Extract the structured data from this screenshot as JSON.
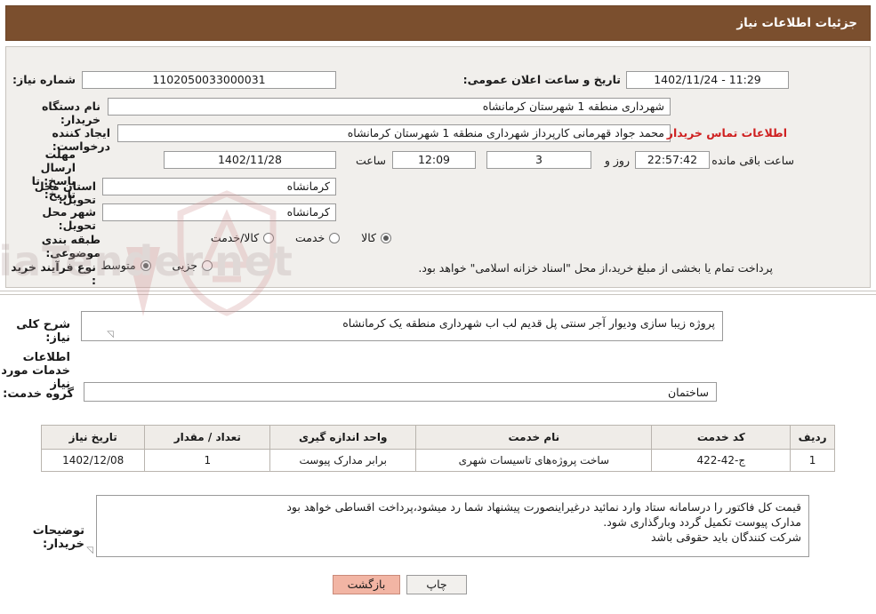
{
  "header": {
    "title": "جزئیات اطلاعات نیاز"
  },
  "form": {
    "need_number_label": "شماره نیاز:",
    "need_number_value": "1102050033000031",
    "announce_datetime_label": "تاریخ و ساعت اعلان عمومی:",
    "announce_datetime_value": "11:29 - 1402/11/24",
    "buyer_org_label": "نام دستگاه خریدار:",
    "buyer_org_value": "شهرداری منطقه 1 شهرستان کرمانشاه",
    "requester_label": "ایجاد کننده درخواست:",
    "requester_value": "محمد جواد قهرمانی کارپرداز شهرداری منطقه 1 شهرستان کرمانشاه",
    "contact_link": "اطلاعات تماس خریدار",
    "deadline_label": "مهلت ارسال پاسخ: تا تاریخ:",
    "deadline_date": "1402/11/28",
    "deadline_hour_label": "ساعت",
    "deadline_hour": "12:09",
    "remaining_days": "3",
    "remaining_days_suffix": "روز و",
    "remaining_time": "22:57:42",
    "remaining_suffix": "ساعت باقی مانده",
    "province_label": "استان محل تحویل:",
    "province_value": "کرمانشاه",
    "city_label": "شهر محل تحویل:",
    "city_value": "کرمانشاه",
    "category_label": "طبقه بندی موضوعی:",
    "category_options": [
      {
        "label": "کالا",
        "selected": true
      },
      {
        "label": "خدمت",
        "selected": false
      },
      {
        "label": "کالا/خدمت",
        "selected": false
      }
    ],
    "purchase_type_label": "نوع فرآیند خرید :",
    "purchase_type_options": [
      {
        "label": "جزیی",
        "selected": false
      },
      {
        "label": "متوسط",
        "selected": true
      }
    ],
    "purchase_note": "پرداخت تمام یا بخشی از مبلغ خرید،از محل \"اسناد خزانه اسلامی\" خواهد بود."
  },
  "general_desc": {
    "label": "شرح کلی نیاز:",
    "value": "پروژه زیبا سازی ودیوار آجر سنتی پل قدیم لب اب  شهرداری منطقه یک کرمانشاه"
  },
  "services_section": {
    "heading": "اطلاعات خدمات مورد نیاز",
    "group_label": "گروه خدمت:",
    "group_value": "ساختمان"
  },
  "table": {
    "headers": [
      "ردیف",
      "کد خدمت",
      "نام خدمت",
      "واحد اندازه گیری",
      "تعداد / مقدار",
      "تاریخ نیاز"
    ],
    "rows": [
      {
        "row": "1",
        "code": "ج-42-422",
        "name": "ساخت پروژه‌های تاسیسات شهری",
        "unit": "برابر مدارک پیوست",
        "qty": "1",
        "date": "1402/12/08"
      }
    ]
  },
  "buyer_notes": {
    "label": "توضیحات خریدار:",
    "lines": [
      "قیمت کل فاکتور را درسامانه ستاد وارد نمائید درغیراینصورت پیشنهاد شما رد میشود،پرداخت اقساطی خواهد بود",
      "مدارک پیوست تکمیل گردد وبارگذاری شود.",
      "شرکت کنندگان باید حقوقی باشد"
    ]
  },
  "footer": {
    "print_label": "چاپ",
    "back_label": "بازگشت"
  },
  "watermark": {
    "text": "AriaTender.net"
  },
  "colors": {
    "header_bg": "#7b4f2e",
    "panel_bg": "#f1efec",
    "link_red": "#cf2020",
    "back_button": "#f2b5a4"
  }
}
